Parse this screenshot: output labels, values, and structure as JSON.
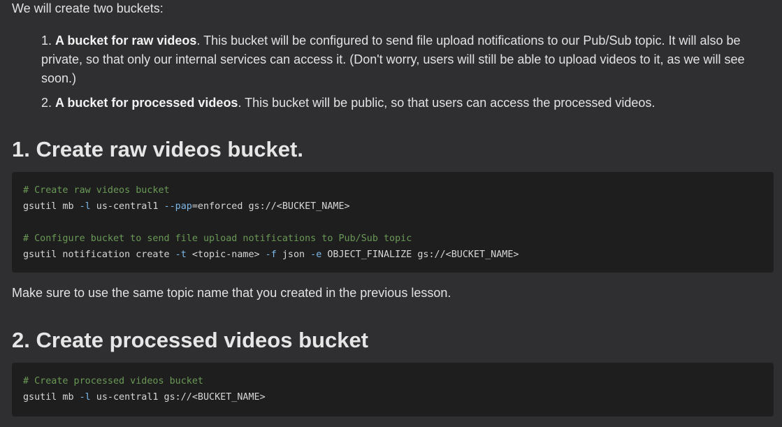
{
  "intro": "We will create two buckets:",
  "list": [
    {
      "number": "1.",
      "bold": "A bucket for raw videos",
      "rest": ". This bucket will be configured to send file upload notifications to our Pub/Sub topic. It will also be private, so that only our internal services can access it. (Don't worry, users will still be able to upload videos to it, as we will see soon.)"
    },
    {
      "number": "2.",
      "bold": "A bucket for processed videos",
      "rest": ". This bucket will be public, so that users can access the processed videos."
    }
  ],
  "section_raw": {
    "heading": "1. Create raw videos bucket.",
    "code": {
      "comment1": "# Create raw videos bucket",
      "cmd1_a": "gsutil mb ",
      "cmd1_flag1": "-l",
      "cmd1_b": " us-central1 ",
      "cmd1_flag2": "--pap",
      "cmd1_c": "=enforced gs://<BUCKET_NAME>",
      "comment2": "# Configure bucket to send file upload notifications to Pub/Sub topic",
      "cmd2_a": "gsutil notification create ",
      "cmd2_flag1": "-t",
      "cmd2_b": " <topic-name> ",
      "cmd2_flag2": "-f",
      "cmd2_c": " json ",
      "cmd2_flag3": "-e",
      "cmd2_d": " OBJECT_FINALIZE gs://<BUCKET_NAME>"
    }
  },
  "note": "Make sure to use the same topic name that you created in the previous lesson.",
  "section_proc": {
    "heading": "2. Create processed videos bucket",
    "code": {
      "comment1": "# Create processed videos bucket",
      "cmd1_a": "gsutil mb ",
      "cmd1_flag1": "-l",
      "cmd1_b": " us-central1 gs://<BUCKET_NAME>"
    }
  },
  "colors": {
    "background": "#2f2f32",
    "code_background": "#1e1e1f",
    "comment": "#6a9955",
    "flag": "#7cb7e6"
  }
}
